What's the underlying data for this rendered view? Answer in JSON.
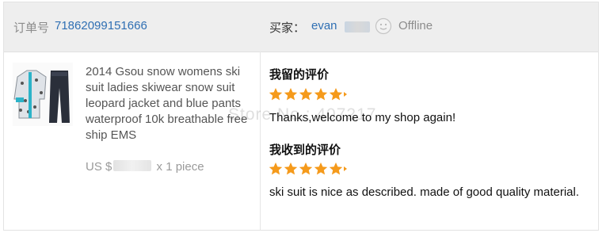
{
  "header": {
    "order_label": "订单号",
    "order_number": "71862099151666",
    "buyer_label": "买家：",
    "buyer_name": "evan",
    "status": "Offline"
  },
  "product": {
    "title": "2014 Gsou snow womens ski suit ladies skiwear snow suit leopard jacket and blue pants waterproof 10k breathable free ship EMS",
    "price_prefix": "US $",
    "quantity": "x 1 piece"
  },
  "my_review": {
    "title": "我留的评价",
    "rating": 5,
    "text": "Thanks,welcome to my shop again!"
  },
  "received_review": {
    "title": "我收到的评价",
    "rating": 5,
    "text": "ski suit is nice as described. made of good quality material."
  },
  "watermark": "Store No.: 407217",
  "colors": {
    "link": "#2f6fb3",
    "star": "#f59a1b",
    "header_bg": "#eeeeee"
  },
  "icons": {
    "status": "offline-smiley-icon",
    "star": "star-icon"
  }
}
